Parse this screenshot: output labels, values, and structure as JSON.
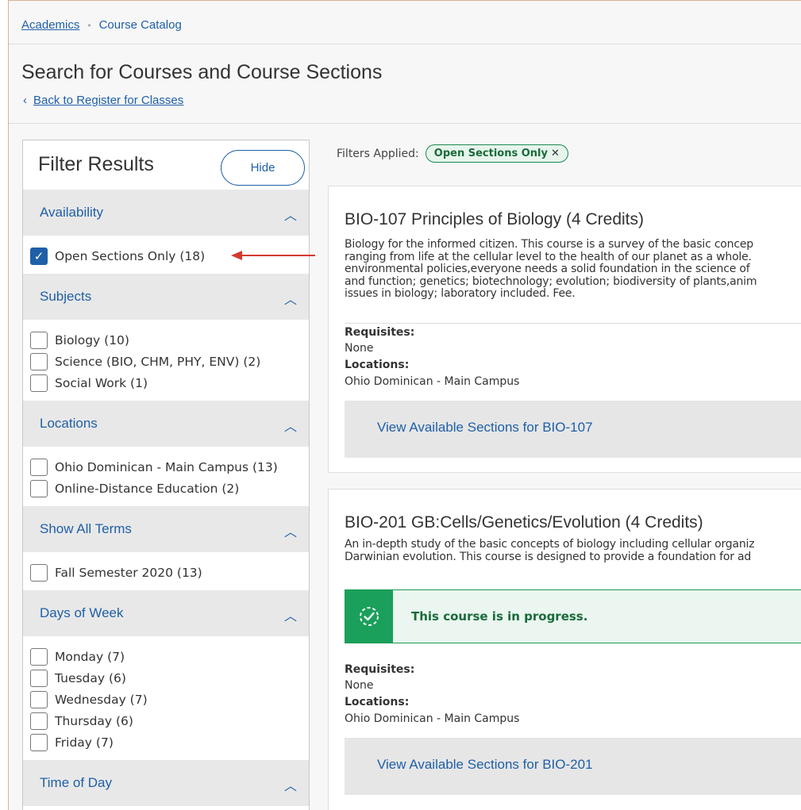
{
  "breadcrumb": {
    "home": "Academics",
    "current": "Course Catalog"
  },
  "page": {
    "title": "Search for Courses and Course Sections",
    "back_label": "Back to Register for Classes"
  },
  "filter": {
    "title": "Filter Results",
    "hide_label": "Hide",
    "sections": [
      {
        "label": "Availability",
        "options": [
          {
            "label": "Open Sections Only (18)",
            "checked": true
          }
        ]
      },
      {
        "label": "Subjects",
        "options": [
          {
            "label": "Biology (10)",
            "checked": false
          },
          {
            "label": "Science (BIO, CHM, PHY, ENV) (2)",
            "checked": false
          },
          {
            "label": "Social Work (1)",
            "checked": false
          }
        ]
      },
      {
        "label": "Locations",
        "options": [
          {
            "label": "Ohio Dominican - Main Campus (13)",
            "checked": false
          },
          {
            "label": "Online-Distance Education (2)",
            "checked": false
          }
        ]
      },
      {
        "label": "Show All Terms",
        "options": [
          {
            "label": "Fall Semester 2020 (13)",
            "checked": false
          }
        ]
      },
      {
        "label": "Days of Week",
        "options": [
          {
            "label": "Monday (7)",
            "checked": false
          },
          {
            "label": "Tuesday (6)",
            "checked": false
          },
          {
            "label": "Wednesday (7)",
            "checked": false
          },
          {
            "label": "Thursday (6)",
            "checked": false
          },
          {
            "label": "Friday (7)",
            "checked": false
          }
        ]
      },
      {
        "label": "Time of Day",
        "options": []
      }
    ]
  },
  "applied": {
    "label": "Filters Applied:",
    "chip": "Open Sections Only",
    "chip_close": "✕"
  },
  "courses": [
    {
      "title": "BIO-107 Principles of Biology (4 Credits)",
      "description_lines": [
        "Biology for the informed citizen. This course is a survey of the basic concep",
        "ranging from life at the cellular level to the health of our planet as a whole.",
        "environmental policies,everyone needs a solid foundation in the science of",
        "and function; genetics; biotechnology; evolution; biodiversity of plants,anim",
        "issues in biology; laboratory included. Fee."
      ],
      "requisites_label": "Requisites:",
      "requisites": "None",
      "locations_label": "Locations:",
      "locations": "Ohio Dominican - Main Campus",
      "sections_link": "View Available Sections for BIO-107"
    },
    {
      "title": "BIO-201 GB:Cells/Genetics/Evolution (4 Credits)",
      "description_lines": [
        "An in-depth study of the basic concepts of biology including cellular organiz",
        "Darwinian evolution. This course is designed to provide a foundation for ad"
      ],
      "progress_message": "This course is in progress.",
      "requisites_label": "Requisites:",
      "requisites": "None",
      "locations_label": "Locations:",
      "locations": "Ohio Dominican - Main Campus",
      "sections_link": "View Available Sections for BIO-201"
    }
  ],
  "colors": {
    "link": "#1f5fa8",
    "success": "#1aa05a",
    "annotation_arrow": "#d43a2f"
  }
}
